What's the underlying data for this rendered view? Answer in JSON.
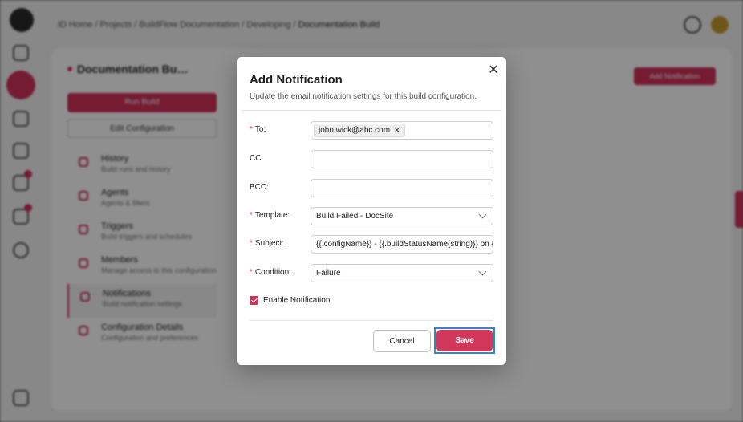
{
  "background": {
    "breadcrumb": [
      "ID Home",
      "Projects",
      "BuildFlow Documentation",
      "Developing"
    ],
    "breadcrumb_current": "Documentation Build",
    "config_title": "Documentation Bu…",
    "run_label": "Run Build",
    "edit_label": "Edit Configuration",
    "add_button": "Add Notification",
    "nav": [
      {
        "title": "History",
        "subtitle": "Build runs and history"
      },
      {
        "title": "Agents",
        "subtitle": "Agents & filters"
      },
      {
        "title": "Triggers",
        "subtitle": "Build triggers and schedules"
      },
      {
        "title": "Members",
        "subtitle": "Manage access to this configuration"
      },
      {
        "title": "Notifications",
        "subtitle": "Build notification settings"
      },
      {
        "title": "Configuration Details",
        "subtitle": "Configuration and preferences"
      }
    ]
  },
  "modal": {
    "title": "Add Notification",
    "subtitle": "Update the email notification settings for this build configuration.",
    "close_glyph": "✕",
    "fields": {
      "to": {
        "label": "To:",
        "required": "*",
        "chips": [
          "john.wick@abc.com"
        ],
        "chip_remove": "✕"
      },
      "cc": {
        "label": "CC:",
        "value": ""
      },
      "bcc": {
        "label": "BCC:",
        "value": ""
      },
      "template": {
        "label": "Template:",
        "required": "*",
        "value": "Build Failed - DocSite"
      },
      "subject": {
        "label": "Subject:",
        "required": "*",
        "value": "{{.configName}} - {{.buildStatusName(string)}} on {{."
      },
      "condition": {
        "label": "Condition:",
        "required": "*",
        "value": "Failure"
      }
    },
    "enable_notification": {
      "label": "Enable Notification",
      "checked": true
    },
    "cancel_label": "Cancel",
    "save_label": "Save"
  },
  "colors": {
    "accent": "#d2375c",
    "focus_ring": "#2d84d8"
  },
  "icons": [
    "app-logo-icon",
    "close-icon",
    "chevron-down-icon",
    "checkbox-checked-icon",
    "help-icon"
  ]
}
